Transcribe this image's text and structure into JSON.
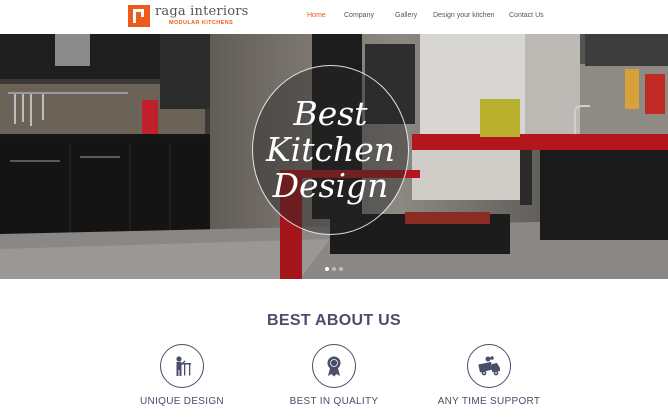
{
  "brand": {
    "name": "raga interiors",
    "tagline": "MODULAR KITCHENS",
    "accent_color": "#ee5a1c"
  },
  "nav": {
    "items": [
      {
        "label": "Home",
        "active": true
      },
      {
        "label": "Company",
        "active": false
      },
      {
        "label": "Gallery",
        "active": false
      },
      {
        "label": "Design your kitchen",
        "active": false
      },
      {
        "label": "Contact Us",
        "active": false
      }
    ]
  },
  "hero": {
    "lines": [
      "Best",
      "Kitchen",
      "Design"
    ],
    "slide_count": 3,
    "active_slide": 1
  },
  "about": {
    "title": "BEST ABOUT US",
    "features": [
      {
        "label": "UNIQUE DESIGN",
        "icon": "designer-icon"
      },
      {
        "label": "BEST IN QUALITY",
        "icon": "award-medal-icon"
      },
      {
        "label": "ANY TIME SUPPORT",
        "icon": "delivery-truck-icon"
      }
    ]
  },
  "colors": {
    "heading": "#4a4e6a",
    "nav_text": "#555555",
    "kitchen_red": "#b5161e"
  }
}
